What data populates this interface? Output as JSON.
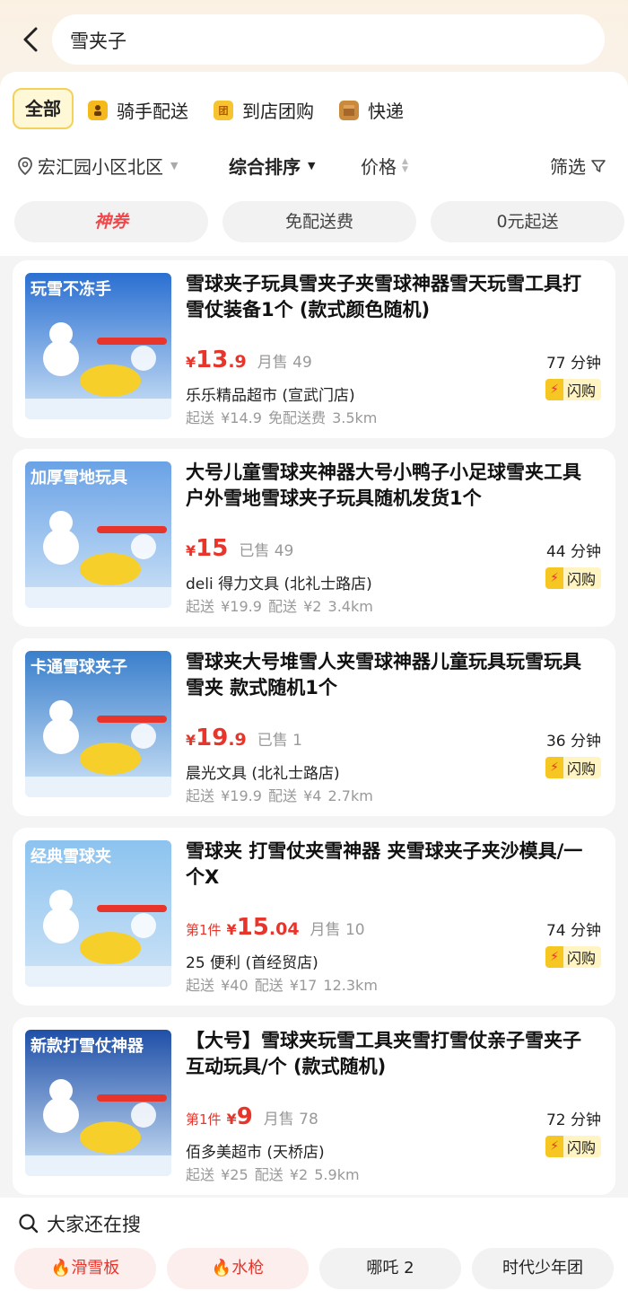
{
  "search": {
    "query": "雪夹子"
  },
  "tabs": [
    {
      "label": "全部",
      "icon": ""
    },
    {
      "label": "骑手配送",
      "icon": "rider-icon"
    },
    {
      "label": "到店团购",
      "icon": "group-buy-icon",
      "icon_text": "团"
    },
    {
      "label": "快递",
      "icon": "package-icon"
    }
  ],
  "sortbar": {
    "location": "宏汇园小区北区",
    "sort": "综合排序",
    "price": "价格",
    "filter": "筛选"
  },
  "chips": [
    {
      "label": "神券",
      "hot": true
    },
    {
      "label": "免配送费",
      "hot": false
    },
    {
      "label": "0元起送",
      "hot": false
    }
  ],
  "products": [
    {
      "title": "雪球夹子玩具雪夹子夹雪球神器雪天玩雪工具打雪仗装备1个 (款式颜色随机)",
      "banner": "玩雪不冻手",
      "price_prefix": "",
      "price_int": "13",
      "price_dec": ".9",
      "sold": "月售 49",
      "shop": "乐乐精品超市 (宣武门店)",
      "meta": "起送 ¥14.9  免配送费  3.5km",
      "eta": "77 分钟",
      "badge": "闪购",
      "thumb_color": "#2a6fd1"
    },
    {
      "title": "大号儿童雪球夹神器大号小鸭子小足球雪夹工具户外雪地雪球夹子玩具随机发货1个",
      "banner": "加厚雪地玩具",
      "price_prefix": "",
      "price_int": "15",
      "price_dec": "",
      "sold": "已售 49",
      "shop": "deli 得力文具 (北礼士路店)",
      "meta": "起送 ¥19.9  配送 ¥2  3.4km",
      "eta": "44 分钟",
      "badge": "闪购",
      "thumb_color": "#6aa2e6"
    },
    {
      "title": "雪球夹大号堆雪人夹雪球神器儿童玩具玩雪玩具雪夹 款式随机1个",
      "banner": "卡通雪球夹子",
      "price_prefix": "",
      "price_int": "19",
      "price_dec": ".9",
      "sold": "已售 1",
      "shop": "晨光文具 (北礼士路店)",
      "meta": "起送 ¥19.9  配送 ¥4  2.7km",
      "eta": "36 分钟",
      "badge": "闪购",
      "thumb_color": "#3a7fcc"
    },
    {
      "title": "雪球夹 打雪仗夹雪神器 夹雪球夹子夹沙模具/一个X",
      "banner": "经典雪球夹",
      "price_prefix": "第1件",
      "price_int": "15",
      "price_dec": ".04",
      "sold": "月售 10",
      "shop": "25 便利 (首经贸店)",
      "meta": "起送 ¥40  配送 ¥17  12.3km",
      "eta": "74 分钟",
      "badge": "闪购",
      "thumb_color": "#8cc3ef"
    },
    {
      "title": "【大号】雪球夹玩雪工具夹雪打雪仗亲子雪夹子互动玩具/个 (款式随机)",
      "banner": "新款打雪仗神器",
      "price_prefix": "第1件",
      "price_int": "9",
      "price_dec": "",
      "sold": "月售 78",
      "shop": "佰多美超市 (天桥店)",
      "meta": "起送 ¥25  配送 ¥2  5.9km",
      "eta": "72 分钟",
      "badge": "闪购",
      "thumb_color": "#1f4fa8"
    }
  ],
  "suggestions": {
    "title": "大家还在搜",
    "items": [
      {
        "label": "滑雪板",
        "hot": true
      },
      {
        "label": "水枪",
        "hot": true
      },
      {
        "label": "哪吒 2",
        "hot": false
      },
      {
        "label": "时代少年团",
        "hot": false
      }
    ]
  },
  "colors": {
    "accent_red": "#e8352b",
    "tab_yellow": "#f3d15a"
  }
}
